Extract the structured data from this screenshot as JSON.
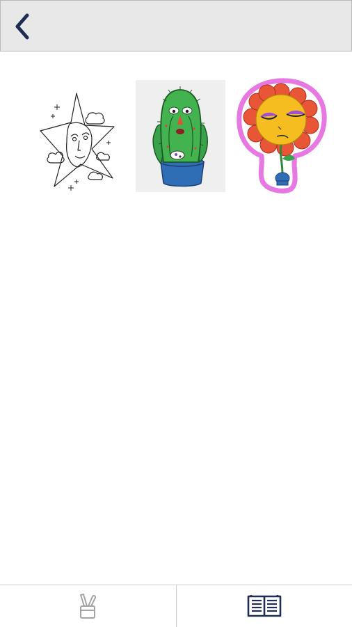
{
  "header": {
    "back_icon": "chevron-left-icon",
    "accent": "#1f2d52"
  },
  "gallery": {
    "items": [
      {
        "name": "star-face-drawing",
        "style": "line-art"
      },
      {
        "name": "cactus-drawing",
        "style": "colored"
      },
      {
        "name": "sunflower-sticker",
        "style": "colored"
      }
    ]
  },
  "bottom_nav": {
    "tabs": [
      {
        "icon": "paint-brushes-cup-icon",
        "active": false
      },
      {
        "icon": "open-book-icon",
        "active": true
      }
    ],
    "colors": {
      "inactive": "#a4a4a4",
      "active": "#1f2d52"
    }
  }
}
